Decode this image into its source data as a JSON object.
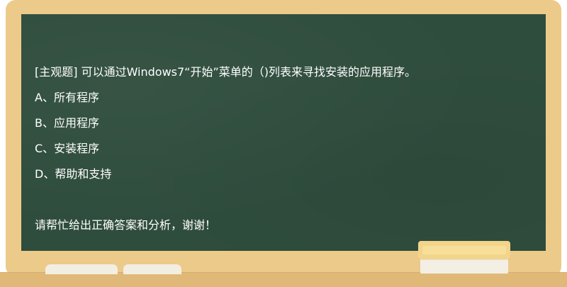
{
  "question": {
    "stem": "[主观题] 可以通过Windows7“开始”菜单的（)列表来寻找安装的应用程序。",
    "options": [
      "A、所有程序",
      "B、应用程序",
      "C、安装程序",
      "D、帮助和支持"
    ],
    "request": "请帮忙给出正确答案和分析，谢谢！"
  },
  "colors": {
    "board": "#2f4d3d",
    "frame": "#ecca8a",
    "text": "#ffffff"
  }
}
